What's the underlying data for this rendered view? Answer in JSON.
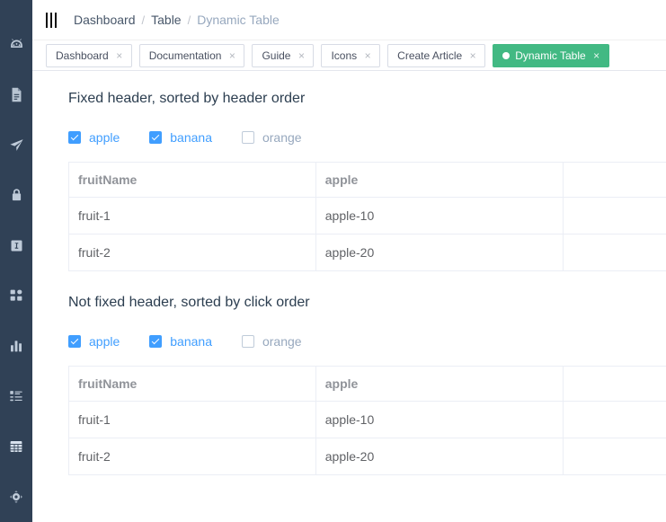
{
  "sidebar": {
    "items": [
      {
        "icon": "dashboard-gauge-icon",
        "name": "sidebar-item-dashboard",
        "active": false
      },
      {
        "icon": "document-icon",
        "name": "sidebar-item-documentation",
        "active": false
      },
      {
        "icon": "paper-plane-icon",
        "name": "sidebar-item-guide",
        "active": false
      },
      {
        "icon": "lock-icon",
        "name": "sidebar-item-permission",
        "active": false
      },
      {
        "icon": "icons-box-icon",
        "name": "sidebar-item-icons",
        "active": false
      },
      {
        "icon": "components-grid-icon",
        "name": "sidebar-item-components",
        "active": false
      },
      {
        "icon": "bar-chart-icon",
        "name": "sidebar-item-charts",
        "active": false
      },
      {
        "icon": "nested-list-icon",
        "name": "sidebar-item-nested-routes",
        "active": false
      },
      {
        "icon": "table-icon",
        "name": "sidebar-item-table",
        "active": true
      },
      {
        "icon": "target-icon",
        "name": "sidebar-item-example",
        "active": false
      }
    ]
  },
  "navbar": {
    "hamburger_icon": "hamburger-icon",
    "breadcrumb": [
      {
        "label": "Dashboard",
        "current": false
      },
      {
        "label": "Table",
        "current": false
      },
      {
        "label": "Dynamic Table",
        "current": true
      }
    ],
    "separator": "/"
  },
  "tabs": {
    "close_glyph": "×",
    "items": [
      {
        "label": "Dashboard",
        "active": false
      },
      {
        "label": "Documentation",
        "active": false
      },
      {
        "label": "Guide",
        "active": false
      },
      {
        "label": "Icons",
        "active": false
      },
      {
        "label": "Create Article",
        "active": false
      },
      {
        "label": "Dynamic Table",
        "active": true
      }
    ]
  },
  "colors": {
    "sidebar_bg": "#304156",
    "accent_green": "#42b983",
    "checkbox_blue": "#409eff",
    "breadcrumb_active": "#48576a",
    "breadcrumb_current": "#97a8be",
    "table_border": "#ebeef5"
  },
  "sections": [
    {
      "title": "Fixed header, sorted by header order",
      "checkboxes": [
        {
          "label": "apple",
          "checked": true
        },
        {
          "label": "banana",
          "checked": true
        },
        {
          "label": "orange",
          "checked": false
        }
      ],
      "table": {
        "columns": [
          "fruitName",
          "apple",
          "",
          ""
        ],
        "rows": [
          [
            "fruit-1",
            "apple-10",
            "",
            ""
          ],
          [
            "fruit-2",
            "apple-20",
            "",
            ""
          ]
        ]
      }
    },
    {
      "title": "Not fixed header, sorted by click order",
      "checkboxes": [
        {
          "label": "apple",
          "checked": true
        },
        {
          "label": "banana",
          "checked": true
        },
        {
          "label": "orange",
          "checked": false
        }
      ],
      "table": {
        "columns": [
          "fruitName",
          "apple",
          "",
          ""
        ],
        "rows": [
          [
            "fruit-1",
            "apple-10",
            "",
            ""
          ],
          [
            "fruit-2",
            "apple-20",
            "",
            ""
          ]
        ]
      }
    }
  ]
}
